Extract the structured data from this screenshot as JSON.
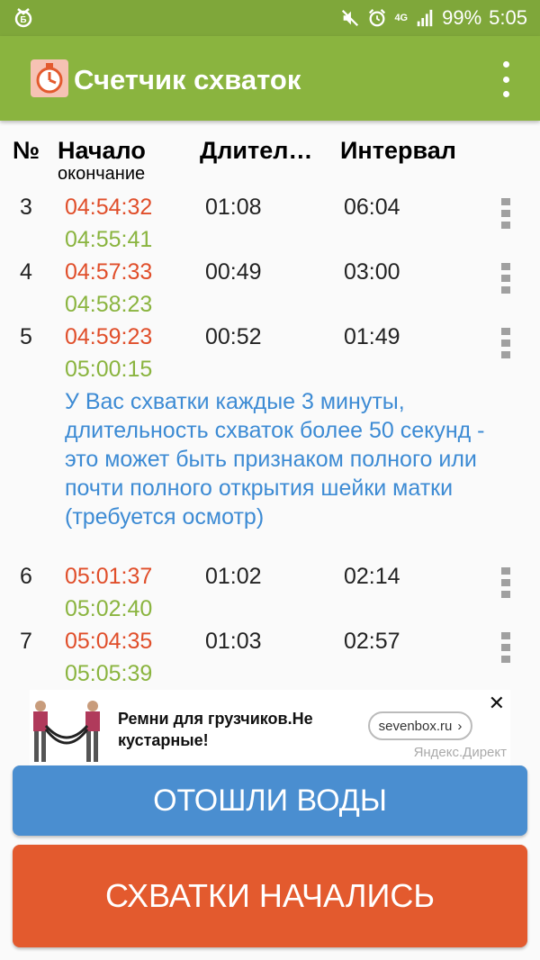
{
  "status_bar": {
    "left_icon": "app-notification-icon",
    "mute_icon": "mute-icon",
    "alarm_icon": "alarm-icon",
    "network": "4G",
    "signal_icon": "signal-icon",
    "battery": "99%",
    "time": "5:05"
  },
  "app_bar": {
    "title": "Счетчик схваток",
    "menu_icon": "more-vert-icon"
  },
  "table": {
    "col_num": "№",
    "col_start": "Начало",
    "col_start_sub": "окончание",
    "col_duration": "Длител…",
    "col_interval": "Интервал",
    "rows": [
      {
        "num": "3",
        "start": "04:54:32",
        "end": "04:55:41",
        "duration": "01:08",
        "interval": "06:04"
      },
      {
        "num": "4",
        "start": "04:57:33",
        "end": "04:58:23",
        "duration": "00:49",
        "interval": "03:00"
      },
      {
        "num": "5",
        "start": "04:59:23",
        "end": "05:00:15",
        "duration": "00:52",
        "interval": "01:49"
      },
      {
        "num": "6",
        "start": "05:01:37",
        "end": "05:02:40",
        "duration": "01:02",
        "interval": "02:14"
      },
      {
        "num": "7",
        "start": "05:04:35",
        "end": "05:05:39",
        "duration": "01:03",
        "interval": "02:57"
      }
    ]
  },
  "warning": "У Вас схватки каждые 3 минуты, длительность схваток более 50 секунд - это может быть признаком полного или почти полного открытия шейки матки (требуется осмотр)",
  "ad": {
    "text": "Ремни для грузчиков.Не кустарные!",
    "link": "sevenbox.ru",
    "link_arrow": "›",
    "close": "✕",
    "source": "Яндекс.Директ"
  },
  "buttons": {
    "water": "ОТОШЛИ ВОДЫ",
    "contractions": "СХВАТКИ НАЧАЛИСЬ"
  },
  "colors": {
    "status_bar": "#7fa73a",
    "app_bar": "#8ab43f",
    "start_time": "#e04e2a",
    "end_time": "#8ab43f",
    "warning_text": "#3d8bd4",
    "water_button": "#4a8ed0",
    "contractions_button": "#e35a2e"
  }
}
